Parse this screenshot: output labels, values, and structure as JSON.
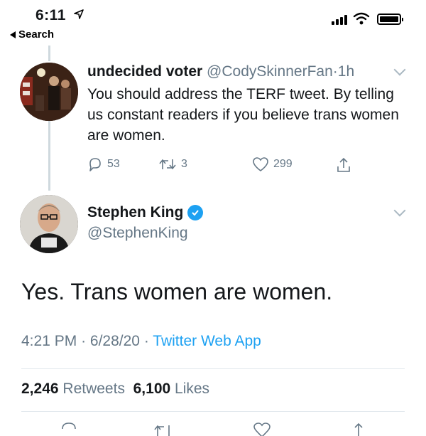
{
  "status_bar": {
    "time": "6:11",
    "back_label": "Search"
  },
  "reply_tweet": {
    "display_name": "undecided voter",
    "handle": "@CodySkinnerFan",
    "separator": "·",
    "age": "1h",
    "text": "You should address the TERF tweet. By telling us constant readers if you believe trans women are women.",
    "reply_count": "53",
    "retweet_count": "3",
    "like_count": "299"
  },
  "main_tweet": {
    "display_name": "Stephen King",
    "handle": "@StephenKing",
    "text": "Yes. Trans women are women.",
    "time": "4:21 PM",
    "date": "6/28/20",
    "separator": "·",
    "source": "Twitter Web App",
    "retweets_count": "2,246",
    "retweets_label": "Retweets",
    "likes_count": "6,100",
    "likes_label": "Likes"
  },
  "colors": {
    "accent": "#1da1f2",
    "secondary_text": "#657786",
    "primary_text": "#14171a",
    "divider": "#e1e8ed"
  },
  "icons": [
    "location-arrow-icon",
    "back-arrow-icon",
    "signal-icon",
    "wifi-icon",
    "battery-icon",
    "chevron-down-icon",
    "reply-icon",
    "retweet-icon",
    "like-icon",
    "share-icon",
    "verified-badge-icon"
  ]
}
